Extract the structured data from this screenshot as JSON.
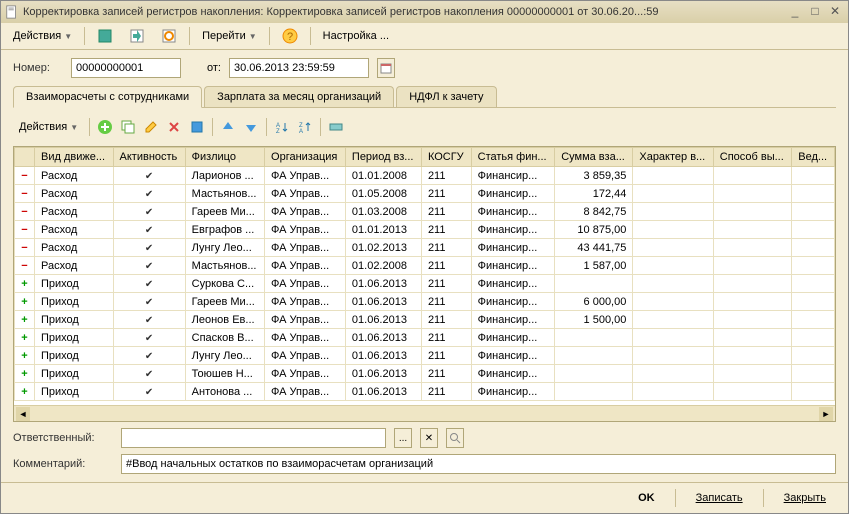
{
  "window": {
    "title": "Корректировка записей регистров накопления: Корректировка записей регистров накопления 00000000001 от 30.06.20...:59"
  },
  "toolbar": {
    "actions": "Действия",
    "go": "Перейти",
    "settings": "Настройка ..."
  },
  "header": {
    "number_label": "Номер:",
    "number": "00000000001",
    "from_label": "от:",
    "from": "30.06.2013 23:59:59"
  },
  "tabs": [
    {
      "label": "Взаиморасчеты с сотрудниками"
    },
    {
      "label": "Зарплата за месяц организаций"
    },
    {
      "label": "НДФЛ к зачету"
    }
  ],
  "inner_toolbar": {
    "actions": "Действия"
  },
  "columns": [
    "",
    "Вид движе...",
    "Активность",
    "Физлицо",
    "Организация",
    "Период вз...",
    "КОСГУ",
    "Статья фин...",
    "Сумма вза...",
    "Характер в...",
    "Способ вы...",
    "Вед..."
  ],
  "rows": [
    {
      "kind": "out",
      "type": "Расход",
      "active": true,
      "person": "Ларионов ...",
      "org": "ФА Управ...",
      "period": "01.01.2008",
      "kosgu": "211",
      "fin": "Финансир...",
      "sum": "3 859,35",
      "char": "",
      "method": "",
      "ved": ""
    },
    {
      "kind": "out",
      "type": "Расход",
      "active": true,
      "person": "Мастьянов...",
      "org": "ФА Управ...",
      "period": "01.05.2008",
      "kosgu": "211",
      "fin": "Финансир...",
      "sum": "172,44",
      "char": "",
      "method": "",
      "ved": ""
    },
    {
      "kind": "out",
      "type": "Расход",
      "active": true,
      "person": "Гареев Ми...",
      "org": "ФА Управ...",
      "period": "01.03.2008",
      "kosgu": "211",
      "fin": "Финансир...",
      "sum": "8 842,75",
      "char": "",
      "method": "",
      "ved": ""
    },
    {
      "kind": "out",
      "type": "Расход",
      "active": true,
      "person": "Евграфов ...",
      "org": "ФА Управ...",
      "period": "01.01.2013",
      "kosgu": "211",
      "fin": "Финансир...",
      "sum": "10 875,00",
      "char": "",
      "method": "",
      "ved": ""
    },
    {
      "kind": "out",
      "type": "Расход",
      "active": true,
      "person": "Лунгу Лео...",
      "org": "ФА Управ...",
      "period": "01.02.2013",
      "kosgu": "211",
      "fin": "Финансир...",
      "sum": "43 441,75",
      "char": "",
      "method": "",
      "ved": ""
    },
    {
      "kind": "out",
      "type": "Расход",
      "active": true,
      "person": "Мастьянов...",
      "org": "ФА Управ...",
      "period": "01.02.2008",
      "kosgu": "211",
      "fin": "Финансир...",
      "sum": "1 587,00",
      "char": "",
      "method": "",
      "ved": ""
    },
    {
      "kind": "in",
      "type": "Приход",
      "active": true,
      "person": "Суркова С...",
      "org": "ФА Управ...",
      "period": "01.06.2013",
      "kosgu": "211",
      "fin": "Финансир...",
      "sum": "",
      "char": "",
      "method": "",
      "ved": ""
    },
    {
      "kind": "in",
      "type": "Приход",
      "active": true,
      "person": "Гареев Ми...",
      "org": "ФА Управ...",
      "period": "01.06.2013",
      "kosgu": "211",
      "fin": "Финансир...",
      "sum": "6 000,00",
      "char": "",
      "method": "",
      "ved": ""
    },
    {
      "kind": "in",
      "type": "Приход",
      "active": true,
      "person": "Леонов Ев...",
      "org": "ФА Управ...",
      "period": "01.06.2013",
      "kosgu": "211",
      "fin": "Финансир...",
      "sum": "1 500,00",
      "char": "",
      "method": "",
      "ved": ""
    },
    {
      "kind": "in",
      "type": "Приход",
      "active": true,
      "person": "Спасков В...",
      "org": "ФА Управ...",
      "period": "01.06.2013",
      "kosgu": "211",
      "fin": "Финансир...",
      "sum": "",
      "char": "",
      "method": "",
      "ved": ""
    },
    {
      "kind": "in",
      "type": "Приход",
      "active": true,
      "person": "Лунгу Лео...",
      "org": "ФА Управ...",
      "period": "01.06.2013",
      "kosgu": "211",
      "fin": "Финансир...",
      "sum": "",
      "char": "",
      "method": "",
      "ved": ""
    },
    {
      "kind": "in",
      "type": "Приход",
      "active": true,
      "person": "Тоюшев Н...",
      "org": "ФА Управ...",
      "period": "01.06.2013",
      "kosgu": "211",
      "fin": "Финансир...",
      "sum": "",
      "char": "",
      "method": "",
      "ved": ""
    },
    {
      "kind": "in",
      "type": "Приход",
      "active": true,
      "person": "Антонова ...",
      "org": "ФА Управ...",
      "period": "01.06.2013",
      "kosgu": "211",
      "fin": "Финансир...",
      "sum": "",
      "char": "",
      "method": "",
      "ved": ""
    }
  ],
  "bottom": {
    "responsible_label": "Ответственный:",
    "responsible": "",
    "comment_label": "Комментарий:",
    "comment": "#Ввод начальных остатков по взаиморасчетам организаций"
  },
  "footer": {
    "ok": "OK",
    "save": "Записать",
    "close": "Закрыть"
  }
}
